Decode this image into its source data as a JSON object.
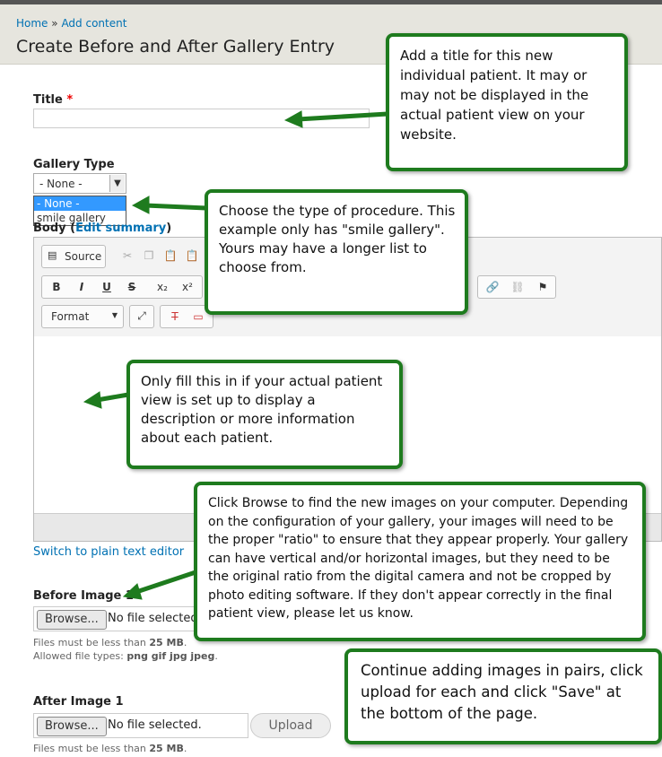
{
  "breadcrumb": {
    "home": "Home",
    "sep": "»",
    "add": "Add content"
  },
  "page_title": "Create Before and After Gallery Entry",
  "title_field": {
    "label": "Title",
    "required": "*",
    "value": ""
  },
  "gallery_type": {
    "label": "Gallery Type",
    "selected": "- None -",
    "options": [
      "- None -",
      "smile gallery"
    ]
  },
  "body": {
    "label": "Body",
    "paren_open": "(",
    "edit_summary": "Edit summary",
    "paren_close": ")"
  },
  "toolbar": {
    "source": "Source",
    "bold": "B",
    "italic": "I",
    "underline": "U",
    "strike": "S",
    "sub": "x₂",
    "sup": "x²",
    "format": "Format"
  },
  "switch_editor": "Switch to plain text editor",
  "before_image": {
    "label": "Before Image 1",
    "browse": "Browse...",
    "no_file": "No file selected.",
    "size_text": "Files must be less than",
    "size_value": "25 MB",
    "size_end": ".",
    "types_text": "Allowed file types:",
    "types_value": "png gif jpg jpeg",
    "types_end": "."
  },
  "after_image": {
    "label": "After Image 1",
    "browse": "Browse...",
    "no_file": "No file selected.",
    "upload": "Upload",
    "size_text": "Files must be less than",
    "size_value": "25 MB",
    "size_end": "."
  },
  "callouts": {
    "title_note": "Add a title for this new individual patient. It may or may not be displayed in the actual patient view on your website.",
    "type_note": "Choose the type of procedure. This example only has \"smile gallery\". Yours may have a longer list to choose from.",
    "body_note": "Only fill this in if your actual patient view is set up to display a description or more information about each patient.",
    "browse_note": "Click Browse to find the new images on your computer. Depending on the configuration of your gallery, your images will need to be the proper \"ratio\" to ensure that they appear properly. Your gallery can have vertical and/or horizontal images, but they need to be the original ratio from the digital camera and not be cropped by photo editing software. If they don't appear correctly in the final patient view, please let us know.",
    "pairs_note": "Continue adding images in pairs, click upload for each and click \"Save\" at the bottom of the page."
  },
  "colors": {
    "callout_border": "#1e7b1e",
    "link": "#0071b3",
    "selected_option": "#3399ff"
  }
}
